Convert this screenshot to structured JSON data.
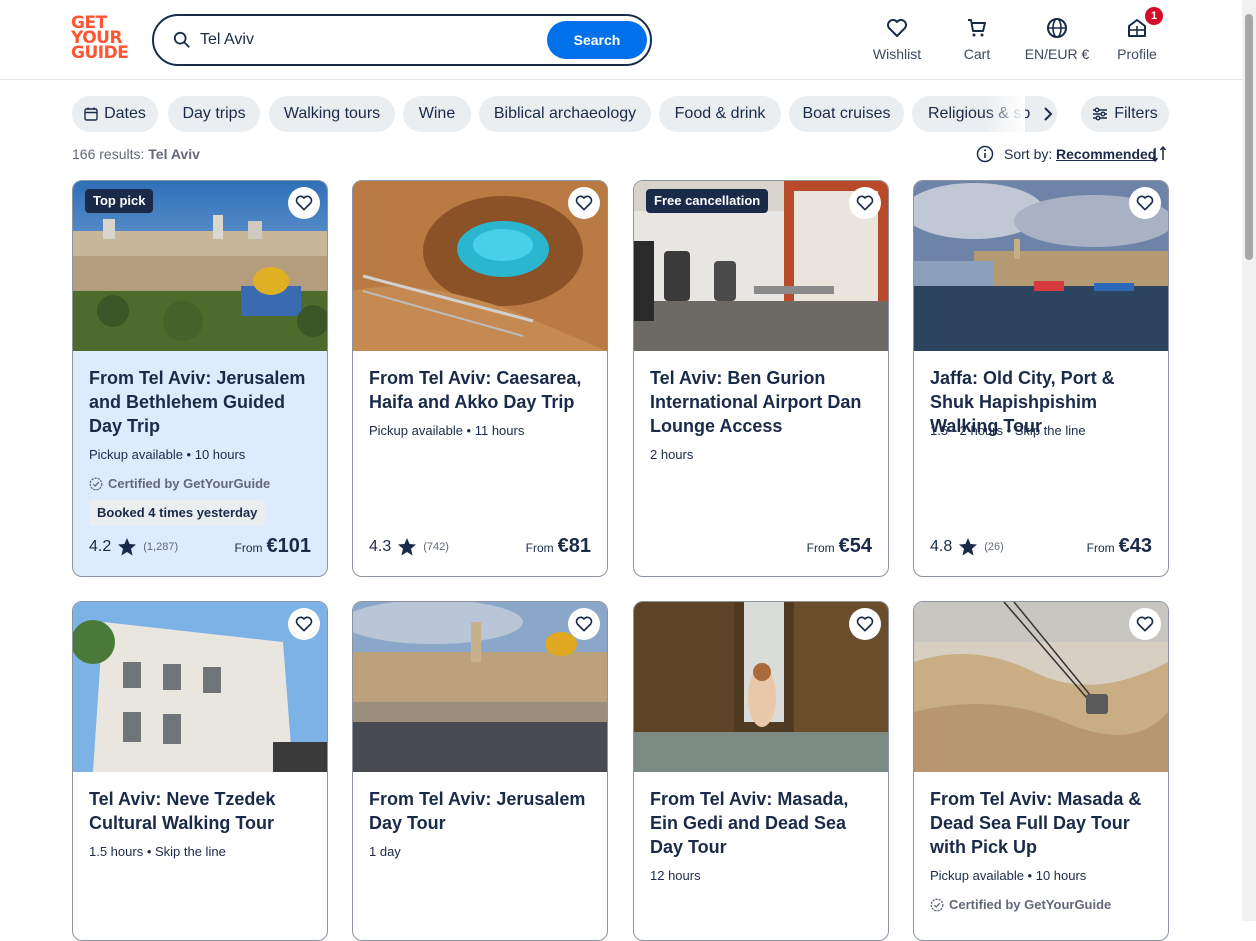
{
  "header": {
    "logo_lines": [
      "GET",
      "YOUR",
      "GUIDE"
    ],
    "search_value": "Tel Aviv",
    "search_button": "Search",
    "nav": [
      {
        "label": "Wishlist",
        "icon": "heart-icon"
      },
      {
        "label": "Cart",
        "icon": "cart-icon"
      },
      {
        "label": "EN/EUR €",
        "icon": "globe-icon"
      },
      {
        "label": "Profile",
        "icon": "profile-icon"
      }
    ],
    "profile_badge": "1"
  },
  "chips": [
    "Dates",
    "Day trips",
    "Walking tours",
    "Wine",
    "Biblical archaeology",
    "Food & drink",
    "Boat cruises",
    "Religious & sp"
  ],
  "filters_label": "Filters",
  "results": {
    "count_text": "166 results:",
    "query": "Tel Aviv",
    "sort_label": "Sort by:",
    "sort_value": "Recommended"
  },
  "cards": [
    {
      "tag": "Top pick",
      "title": "From Tel Aviv: Jerusalem and Bethlehem Guided Day Trip",
      "meta": "Pickup available • 10 hours",
      "cert": "Certified by GetYourGuide",
      "booked": "Booked 4 times yesterday",
      "rating": "4.2",
      "reviews": "(1,287)",
      "from": "From",
      "price": "€101"
    },
    {
      "tag": "",
      "title": "From Tel Aviv: Caesarea, Haifa and Akko Day Trip",
      "meta": "Pickup available • 11 hours",
      "rating": "4.3",
      "reviews": "(742)",
      "from": "From",
      "price": "€81"
    },
    {
      "tag": "Free cancellation",
      "title": "Tel Aviv: Ben Gurion International Airport Dan Lounge Access",
      "meta": "2 hours",
      "from": "From",
      "price": "€54"
    },
    {
      "tag": "",
      "title": "Jaffa: Old City, Port & Shuk Hapishpishim Walking Tour",
      "meta": "1.5 - 2 hours • Skip the line",
      "rating": "4.8",
      "reviews": "(26)",
      "from": "From",
      "price": "€43"
    },
    {
      "tag": "",
      "title": "Tel Aviv: Neve Tzedek Cultural Walking Tour",
      "meta": "1.5 hours • Skip the line"
    },
    {
      "tag": "",
      "title": "From Tel Aviv: Jerusalem Day Tour",
      "meta": "1 day"
    },
    {
      "tag": "",
      "title": "From Tel Aviv: Masada, Ein Gedi and Dead Sea Day Tour",
      "meta": "12 hours"
    },
    {
      "tag": "",
      "title": "From Tel Aviv: Masada & Dead Sea Full Day Tour with Pick Up",
      "meta": "Pickup available • 10 hours",
      "cert": "Certified by GetYourGuide"
    }
  ],
  "colors": {
    "brand": "#ff5533",
    "accent": "#0071eb",
    "text": "#1a2b49",
    "highlight_card": "#dcecfd"
  }
}
